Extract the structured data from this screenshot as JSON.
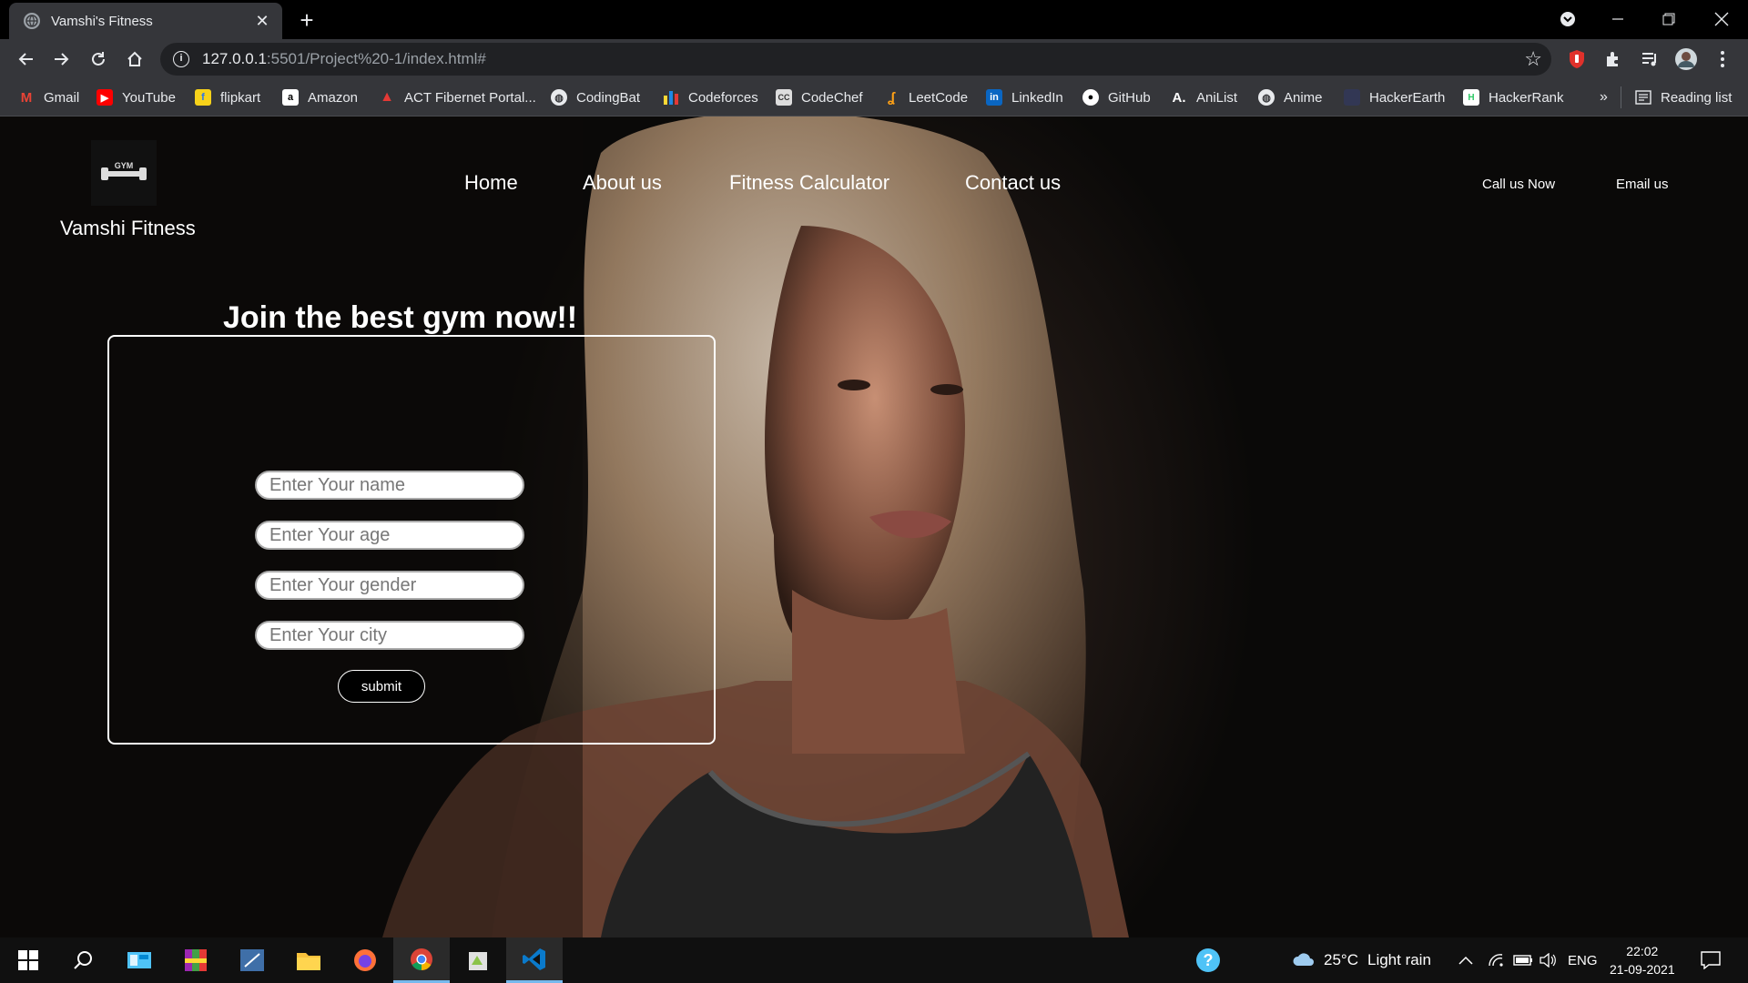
{
  "browser": {
    "tab_title": "Vamshi's Fitness",
    "url_host": "127.0.0.1",
    "url_path": ":5501/Project%20-1/index.html#",
    "bookmarks": [
      {
        "label": "Gmail",
        "icon": "gmail-icon",
        "color": "#ea4335"
      },
      {
        "label": "YouTube",
        "icon": "youtube-icon",
        "color": "#ff0000"
      },
      {
        "label": "flipkart",
        "icon": "flipkart-icon",
        "color": "#f7d21a"
      },
      {
        "label": "Amazon",
        "icon": "amazon-icon",
        "color": "#ffffff"
      },
      {
        "label": "ACT Fibernet Portal...",
        "icon": "act-icon",
        "color": "#e53935"
      },
      {
        "label": "CodingBat",
        "icon": "globe-icon",
        "color": "#e8eaed"
      },
      {
        "label": "Codeforces",
        "icon": "codeforces-icon",
        "color": "#1e88e5"
      },
      {
        "label": "CodeChef",
        "icon": "codechef-icon",
        "color": "#8d6e63"
      },
      {
        "label": "LeetCode",
        "icon": "leetcode-icon",
        "color": "#ffa116"
      },
      {
        "label": "LinkedIn",
        "icon": "linkedin-icon",
        "color": "#0a66c2"
      },
      {
        "label": "GitHub",
        "icon": "github-icon",
        "color": "#ffffff"
      },
      {
        "label": "AniList",
        "icon": "anilist-icon",
        "color": "#02a9ff"
      },
      {
        "label": "Anime",
        "icon": "globe-icon",
        "color": "#e8eaed"
      },
      {
        "label": "HackerEarth",
        "icon": "hackerearth-icon",
        "color": "#323754"
      },
      {
        "label": "HackerRank",
        "icon": "hackerrank-icon",
        "color": "#2ec866"
      }
    ],
    "more_bookmarks": "»",
    "reading_list": "Reading list"
  },
  "site": {
    "brand": "Vamshi Fitness",
    "logo_text": "GYM",
    "nav": [
      "Home",
      "About us",
      "Fitness Calculator",
      "Contact us"
    ],
    "call": "Call us Now",
    "email": "Email us",
    "form": {
      "title": "Join the best gym now!!",
      "name_placeholder": "Enter Your name",
      "age_placeholder": "Enter Your age",
      "gender_placeholder": "Enter Your gender",
      "city_placeholder": "Enter Your city",
      "submit": "submit"
    }
  },
  "taskbar": {
    "weather": "25°C",
    "weather_desc": "Light rain",
    "lang": "ENG",
    "time": "22:02",
    "date": "21-09-2021"
  }
}
